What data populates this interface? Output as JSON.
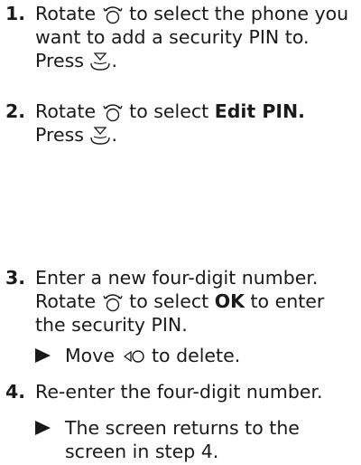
{
  "steps": [
    {
      "num": "1.",
      "t1": "Rotate ",
      "t2": " to select the phone you want to add a security PIN to. Press ",
      "t3": "."
    },
    {
      "num": "2.",
      "t1": "Rotate ",
      "t2": " to select ",
      "bold": "Edit PIN.",
      "t3": " Press ",
      "t4": "."
    },
    {
      "num": "3.",
      "t1": "Enter a new four-digit number. Rotate ",
      "t2": " to select ",
      "bold": "OK",
      "t3": " to enter the security PIN."
    },
    {
      "num": "4.",
      "t1": "Re-enter the four-digit number."
    }
  ],
  "notes": [
    {
      "pre": "Move ",
      "post": " to delete."
    },
    {
      "text": "The screen returns to the screen in step 4."
    }
  ],
  "icons": {
    "rotate": "interface-dial-rotate-icon",
    "press": "interface-dial-press-icon",
    "move_left": "interface-dial-move-left-icon",
    "bullet": "right-triangle-icon"
  }
}
